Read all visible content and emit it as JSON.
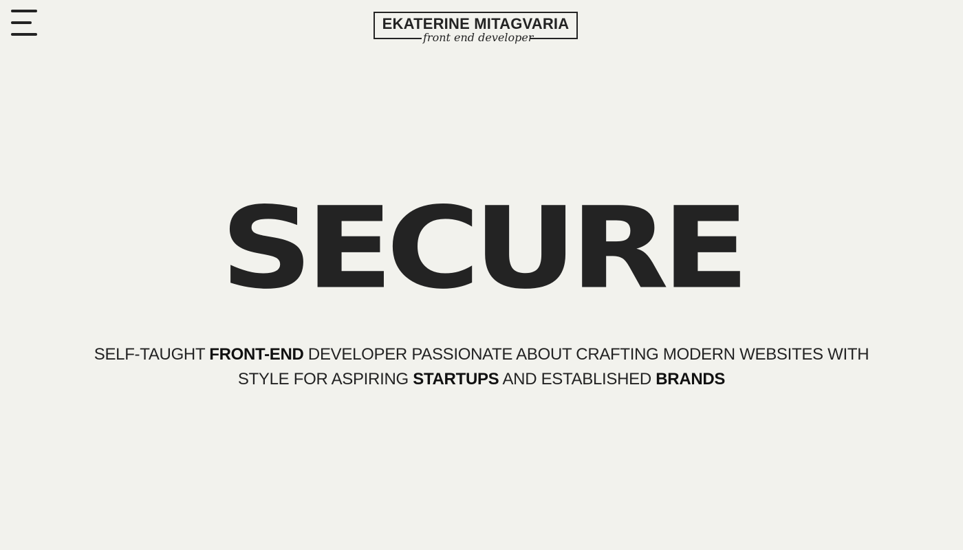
{
  "header": {
    "menu_icon": "hamburger-menu-icon",
    "logo": {
      "name": "EKATERINE MITAGVARIA",
      "tagline": "front end developer"
    }
  },
  "hero": {
    "title": "SECURE",
    "subtitle": {
      "part1": "SELF-TAUGHT ",
      "highlight1": "FRONT-END",
      "part2": " DEVELOPER PASSIONATE ABOUT CRAFTING MODERN WEBSITES WITH STYLE FOR ASPIRING ",
      "highlight2": "STARTUPS",
      "part3": " AND ESTABLISHED ",
      "highlight3": "BRANDS"
    }
  },
  "colors": {
    "background": "#f2f2ed",
    "text": "#232323"
  }
}
